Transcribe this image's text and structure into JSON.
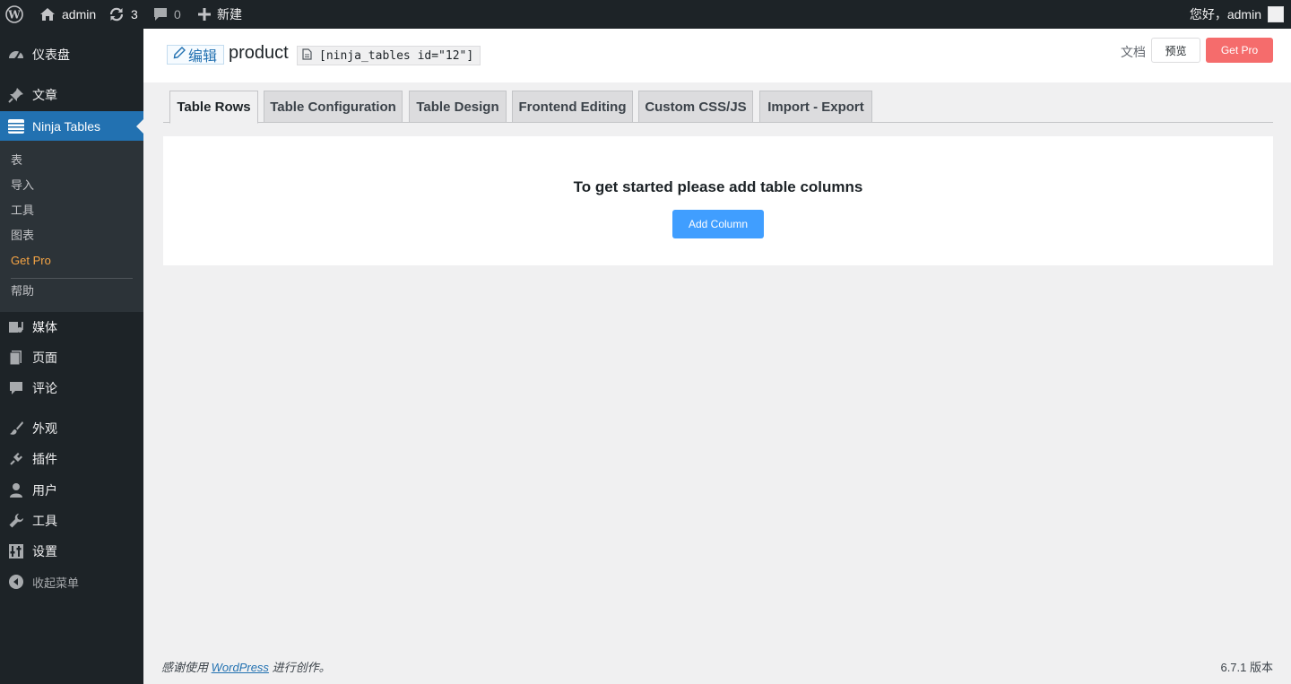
{
  "adminbar": {
    "site_name": "admin",
    "updates_count": "3",
    "comments_count": "0",
    "new_label": "新建",
    "greeting": "您好，admin"
  },
  "sidebar": {
    "dashboard": "仪表盘",
    "posts": "文章",
    "ninja_tables": "Ninja Tables",
    "submenu": {
      "tables": "表",
      "import": "导入",
      "tools": "工具",
      "charts": "图表",
      "get_pro": "Get Pro",
      "help": "帮助"
    },
    "media": "媒体",
    "pages": "页面",
    "comments": "评论",
    "appearance": "外观",
    "plugins": "插件",
    "users": "用户",
    "tools": "工具",
    "settings": "设置",
    "collapse": "收起菜单"
  },
  "header": {
    "edit_label": "编辑",
    "title": "product",
    "shortcode": "[ninja_tables id=\"12\"]",
    "docs_label": "文档",
    "preview_label": "预览",
    "get_pro_label": "Get Pro"
  },
  "tabs": [
    {
      "label": "Table Rows",
      "active": true
    },
    {
      "label": "Table Configuration",
      "active": false
    },
    {
      "label": "Table Design",
      "active": false
    },
    {
      "label": "Frontend Editing",
      "active": false
    },
    {
      "label": "Custom CSS/JS",
      "active": false
    },
    {
      "label": "Import - Export",
      "active": false
    }
  ],
  "content": {
    "empty_message": "To get started please add table columns",
    "add_column_label": "Add Column"
  },
  "footer": {
    "thanks_prefix": "感谢使用",
    "wordpress_link": "WordPress",
    "thanks_suffix": "进行创作。",
    "version": "6.7.1 版本"
  },
  "colors": {
    "adminbar_bg": "#1d2327",
    "active_menu": "#2271b1",
    "get_pro": "#f56c6c",
    "add_column": "#409eff",
    "submenu_pro": "#f6a545"
  }
}
